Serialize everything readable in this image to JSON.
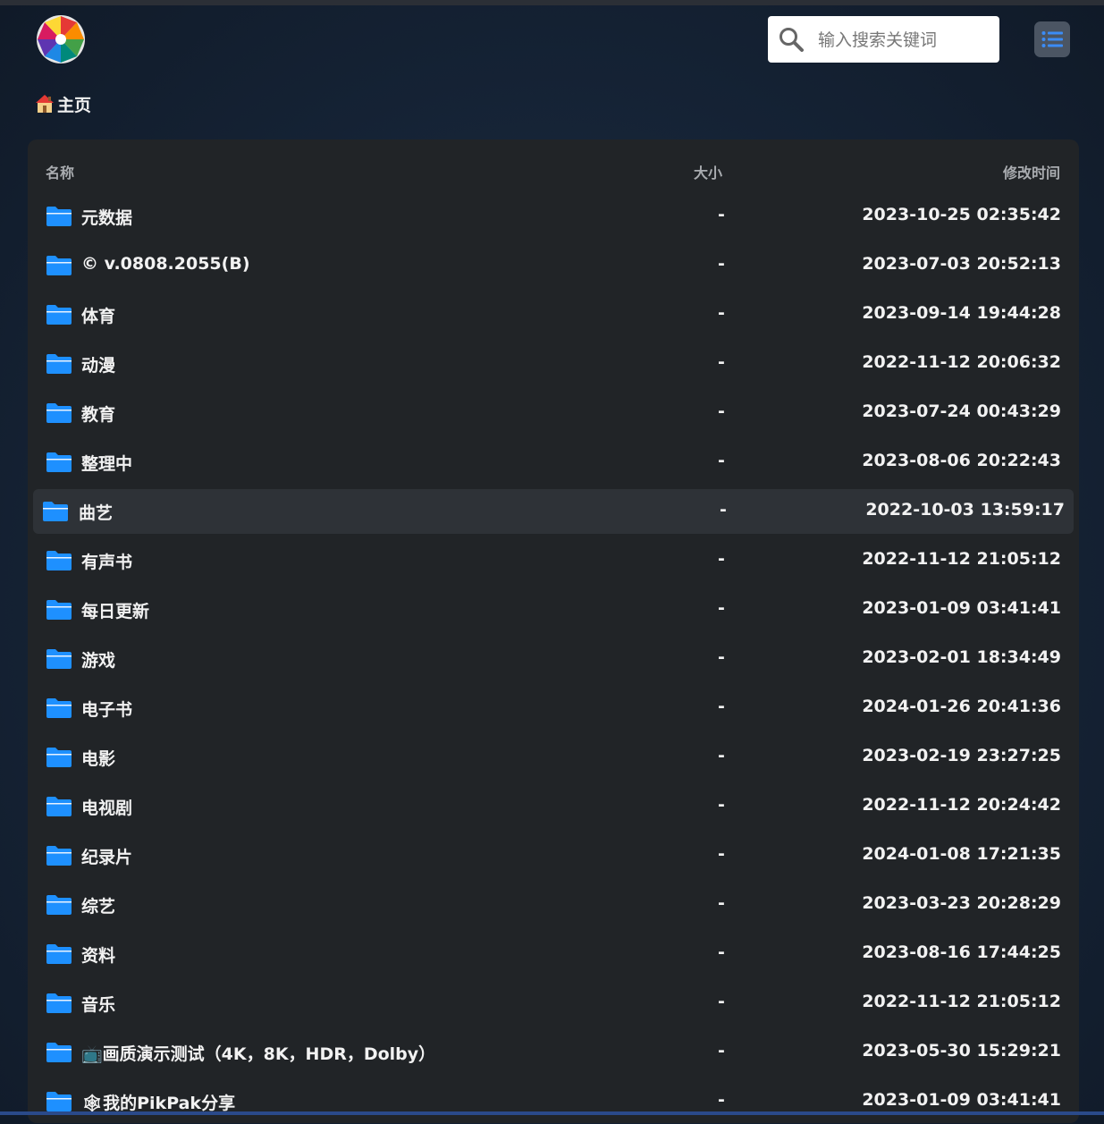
{
  "search": {
    "placeholder": "输入搜索关键词"
  },
  "breadcrumb": {
    "home_label": "主页"
  },
  "table": {
    "headers": {
      "name": "名称",
      "size": "大小",
      "time": "修改时间"
    },
    "rows": [
      {
        "name": "元数据",
        "size": "-",
        "time": "2023-10-25 02:35:42"
      },
      {
        "name": "© v.0808.2055(B)",
        "size": "-",
        "time": "2023-07-03 20:52:13"
      },
      {
        "name": "体育",
        "size": "-",
        "time": "2023-09-14 19:44:28"
      },
      {
        "name": "动漫",
        "size": "-",
        "time": "2022-11-12 20:06:32"
      },
      {
        "name": "教育",
        "size": "-",
        "time": "2023-07-24 00:43:29"
      },
      {
        "name": "整理中",
        "size": "-",
        "time": "2023-08-06 20:22:43"
      },
      {
        "name": "曲艺",
        "size": "-",
        "time": "2022-10-03 13:59:17"
      },
      {
        "name": "有声书",
        "size": "-",
        "time": "2022-11-12 21:05:12"
      },
      {
        "name": "每日更新",
        "size": "-",
        "time": "2023-01-09 03:41:41"
      },
      {
        "name": "游戏",
        "size": "-",
        "time": "2023-02-01 18:34:49"
      },
      {
        "name": "电子书",
        "size": "-",
        "time": "2024-01-26 20:41:36"
      },
      {
        "name": "电影",
        "size": "-",
        "time": "2023-02-19 23:27:25"
      },
      {
        "name": "电视剧",
        "size": "-",
        "time": "2022-11-12 20:24:42"
      },
      {
        "name": "纪录片",
        "size": "-",
        "time": "2024-01-08 17:21:35"
      },
      {
        "name": "综艺",
        "size": "-",
        "time": "2023-03-23 20:28:29"
      },
      {
        "name": "资料",
        "size": "-",
        "time": "2023-08-16 17:44:25"
      },
      {
        "name": "音乐",
        "size": "-",
        "time": "2022-11-12 21:05:12"
      },
      {
        "name": "📺画质演示测试（4K，8K，HDR，Dolby）",
        "size": "-",
        "time": "2023-05-30 15:29:21"
      },
      {
        "name": "🕸我的PikPak分享",
        "size": "-",
        "time": "2023-01-09 03:41:41"
      }
    ]
  },
  "icons": {
    "folder": "folder-icon",
    "search": "search-icon",
    "menu": "list-icon",
    "home": "home-icon",
    "logo": "app-logo"
  },
  "colors": {
    "folder": "#1e90ff",
    "accent": "#3b82f6",
    "panel": "#212427"
  }
}
